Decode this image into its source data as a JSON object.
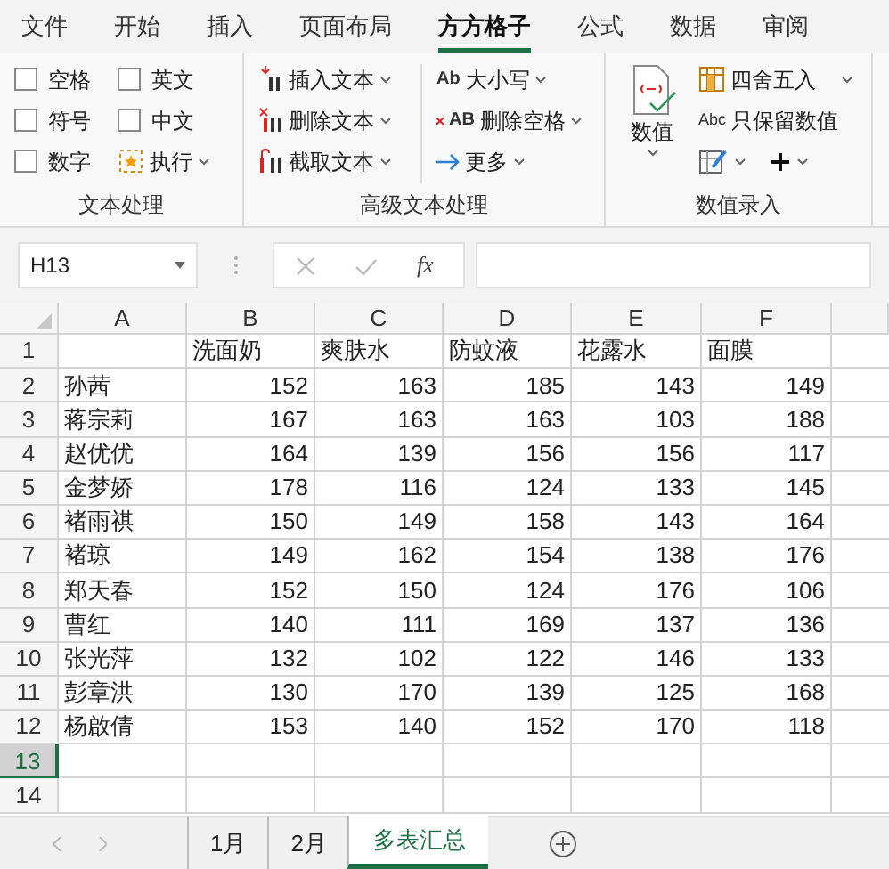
{
  "menu_tabs": [
    {
      "label": "文件",
      "selected": false
    },
    {
      "label": "开始",
      "selected": false
    },
    {
      "label": "插入",
      "selected": false
    },
    {
      "label": "页面布局",
      "selected": false
    },
    {
      "label": "方方格子",
      "selected": true
    },
    {
      "label": "公式",
      "selected": false
    },
    {
      "label": "数据",
      "selected": false
    },
    {
      "label": "审阅",
      "selected": false
    }
  ],
  "ribbon": {
    "text_group": {
      "label": "文本处理",
      "items": [
        {
          "kind": "checkbox",
          "label": "空格",
          "checked": false
        },
        {
          "kind": "checkbox",
          "label": "英文",
          "checked": false
        },
        {
          "kind": "checkbox",
          "label": "符号",
          "checked": false
        },
        {
          "kind": "checkbox",
          "label": "中文",
          "checked": false
        },
        {
          "kind": "checkbox",
          "label": "数字",
          "checked": false
        },
        {
          "kind": "button",
          "label": "执行"
        }
      ]
    },
    "advanced_group": {
      "label": "高级文本处理",
      "columns": [
        [
          {
            "label": "插入文本"
          },
          {
            "label": "删除文本"
          },
          {
            "label": "截取文本"
          }
        ],
        [
          {
            "icon_text": "Ab",
            "label": "大小写"
          },
          {
            "icon_text": "AB",
            "label": "删除空格"
          },
          {
            "label": "更多"
          }
        ]
      ]
    },
    "number_group": {
      "label": "数值录入",
      "big_button": {
        "label": "数值"
      },
      "round_button": {
        "label": "四舍五入"
      },
      "keep_button": {
        "icon_text": "Abc",
        "label": "只保留数值"
      },
      "small_buttons": [
        {
          "kind": "edit"
        },
        {
          "kind": "plus"
        }
      ]
    }
  },
  "formula_bar": {
    "name_box": "H13",
    "function_label": "fx"
  },
  "sheet": {
    "columns": [
      "A",
      "B",
      "C",
      "D",
      "E",
      "F"
    ],
    "rows": [
      {
        "number": "1",
        "selected": false,
        "cells": [
          "",
          "洗面奶",
          "爽肤水",
          "防蚊液",
          "花露水",
          "面膜"
        ]
      },
      {
        "number": "2",
        "selected": false,
        "cells": [
          "孙茜",
          "152",
          "163",
          "185",
          "143",
          "149"
        ]
      },
      {
        "number": "3",
        "selected": false,
        "cells": [
          "蒋宗莉",
          "167",
          "163",
          "163",
          "103",
          "188"
        ]
      },
      {
        "number": "4",
        "selected": false,
        "cells": [
          "赵优优",
          "164",
          "139",
          "156",
          "156",
          "117"
        ]
      },
      {
        "number": "5",
        "selected": false,
        "cells": [
          "金梦娇",
          "178",
          "116",
          "124",
          "133",
          "145"
        ]
      },
      {
        "number": "6",
        "selected": false,
        "cells": [
          "褚雨祺",
          "150",
          "149",
          "158",
          "143",
          "164"
        ]
      },
      {
        "number": "7",
        "selected": false,
        "cells": [
          "褚琼",
          "149",
          "162",
          "154",
          "138",
          "176"
        ]
      },
      {
        "number": "8",
        "selected": false,
        "cells": [
          "郑天春",
          "152",
          "150",
          "124",
          "176",
          "106"
        ]
      },
      {
        "number": "9",
        "selected": false,
        "cells": [
          "曹红",
          "140",
          "111",
          "169",
          "137",
          "136"
        ]
      },
      {
        "number": "10",
        "selected": false,
        "cells": [
          "张光萍",
          "132",
          "102",
          "122",
          "146",
          "133"
        ]
      },
      {
        "number": "11",
        "selected": false,
        "cells": [
          "彭章洪",
          "130",
          "170",
          "139",
          "125",
          "168"
        ]
      },
      {
        "number": "12",
        "selected": false,
        "cells": [
          "杨啟倩",
          "153",
          "140",
          "152",
          "170",
          "118"
        ]
      },
      {
        "number": "13",
        "selected": true,
        "cells": [
          "",
          "",
          "",
          "",
          "",
          ""
        ]
      },
      {
        "number": "14",
        "selected": false,
        "cells": [
          "",
          "",
          "",
          "",
          "",
          ""
        ]
      }
    ]
  },
  "sheet_tabs": [
    {
      "label": "1月",
      "selected": false
    },
    {
      "label": "2月",
      "selected": false
    },
    {
      "label": "多表汇总",
      "selected": true
    }
  ]
}
